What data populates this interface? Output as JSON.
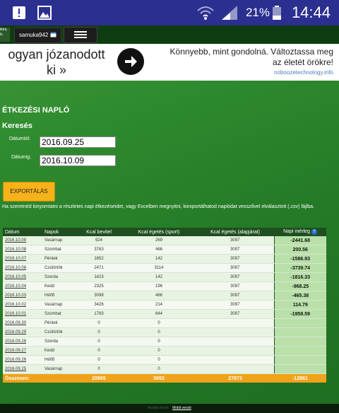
{
  "statusbar": {
    "battery_percent": "21%",
    "time": "14:44",
    "icons": [
      "notification-icon",
      "image-icon",
      "wifi-icon",
      "signal-icon",
      "battery-icon"
    ]
  },
  "topnav": {
    "cut_label": "iktra ls",
    "username": "samuka942",
    "menu_icon": "hamburger-icon"
  },
  "ad": {
    "left_line1": "ogyan józanodott",
    "left_line2": "ki »",
    "right_line1": "Könnyebb, mint gondolná. Változtassa meg",
    "right_line2": "az életét örökre!",
    "url": "noboozetechnology.info"
  },
  "page": {
    "title": "ÉTKEZÉSI NAPLÓ",
    "search_title": "Keresés",
    "from_label": "Dátumtól:",
    "from_value": "2016.09.25",
    "to_label": "Dátumig:",
    "to_value": "2016.10.09",
    "export_label": "EXPORTÁLÁS",
    "info_text": "Ha szeretnéd kinyomtatni a részletes napi étkezéseidet, vagy Excelben megnyitni, kiexportálhatod naplódat vesszővel elválasztott (.csv) fájlba."
  },
  "table": {
    "headers": [
      "Dátum",
      "Napok",
      "Kcal bevitel",
      "Kcal égetés (sport)",
      "Kcal égetés (alapjárat)",
      "Napi mérleg"
    ],
    "rows": [
      {
        "date": "2016.10.09",
        "day": "Vasárnap",
        "intake": "924",
        "sport": "269",
        "base": "3097",
        "balance": "-2441.68"
      },
      {
        "date": "2016.10.08",
        "day": "Szombat",
        "intake": "3763",
        "sport": "466",
        "base": "3097",
        "balance": "200.56"
      },
      {
        "date": "2016.10.07",
        "day": "Péntek",
        "intake": "1652",
        "sport": "142",
        "base": "3097",
        "balance": "-1586.93"
      },
      {
        "date": "2016.10.06",
        "day": "Csütörtök",
        "intake": "2471",
        "sport": "3114",
        "base": "3097",
        "balance": "-3739.74"
      },
      {
        "date": "2016.10.05",
        "day": "Szerda",
        "intake": "1423",
        "sport": "142",
        "base": "3097",
        "balance": "-1816.33"
      },
      {
        "date": "2016.10.04",
        "day": "Kedd",
        "intake": "2325",
        "sport": "196",
        "base": "3097",
        "balance": "-968.25"
      },
      {
        "date": "2016.10.03",
        "day": "Hétfő",
        "intake": "3098",
        "sport": "466",
        "base": "3097",
        "balance": "-465.38"
      },
      {
        "date": "2016.10.02",
        "day": "Vasárnap",
        "intake": "3426",
        "sport": "214",
        "base": "3097",
        "balance": "114.79"
      },
      {
        "date": "2016.10.01",
        "day": "Szombat",
        "intake": "1783",
        "sport": "644",
        "base": "3097",
        "balance": "-1958.59"
      },
      {
        "date": "2016.09.30",
        "day": "Péntek",
        "intake": "0",
        "sport": "0",
        "base": "",
        "balance": ""
      },
      {
        "date": "2016.09.29",
        "day": "Csütörtök",
        "intake": "0",
        "sport": "0",
        "base": "",
        "balance": ""
      },
      {
        "date": "2016.09.28",
        "day": "Szerda",
        "intake": "0",
        "sport": "0",
        "base": "",
        "balance": ""
      },
      {
        "date": "2016.09.27",
        "day": "Kedd",
        "intake": "0",
        "sport": "0",
        "base": "",
        "balance": ""
      },
      {
        "date": "2016.09.26",
        "day": "Hétfő",
        "intake": "0",
        "sport": "0",
        "base": "",
        "balance": ""
      },
      {
        "date": "2016.09.25",
        "day": "Vasárnap",
        "intake": "0",
        "sport": "0",
        "base": "",
        "balance": ""
      }
    ],
    "totals": {
      "label": "Összesen:",
      "intake": "20865",
      "sport": "5653",
      "base": "27873",
      "balance": "-12661"
    }
  },
  "footer": {
    "desktop_link": "Asztali verzió",
    "mobile_link": "Mobil verzió"
  },
  "colors": {
    "status_bar": "#2b2f8f",
    "page_green": "#2e8a2e",
    "nav_dark": "#0f3d12",
    "export_orange": "#f6b21a",
    "totals_orange": "#f0a21a",
    "balance_green": "#b9e0a9"
  }
}
